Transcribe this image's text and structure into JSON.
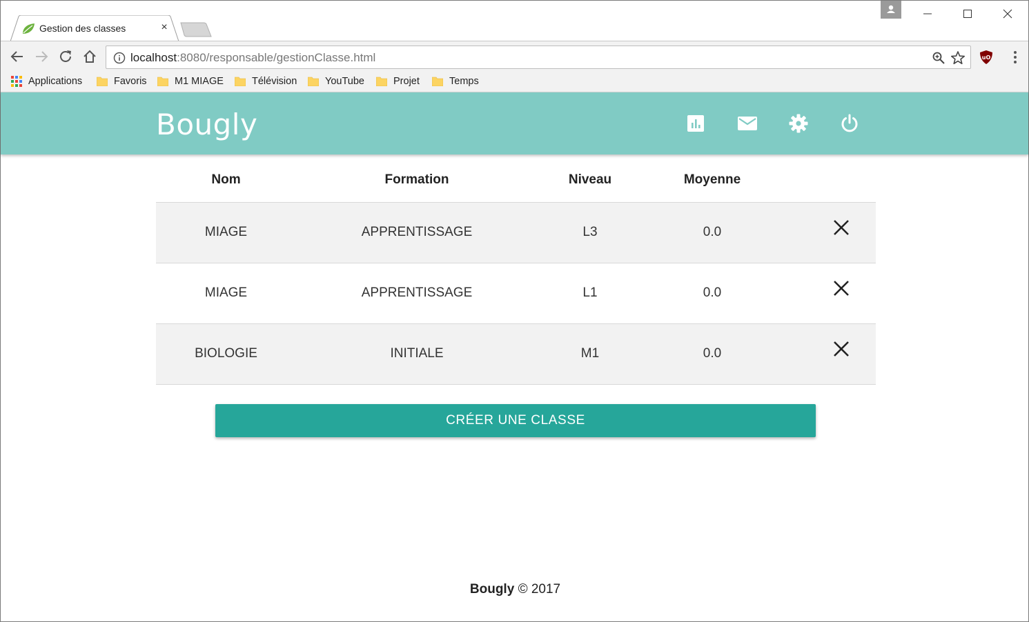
{
  "browser": {
    "tab_title": "Gestion des classes",
    "tab_close": "×",
    "url_host": "localhost",
    "url_rest": ":8080/responsable/gestionClasse.html",
    "bookmarks": [
      {
        "label": "Applications",
        "icon": "apps-grid-icon"
      },
      {
        "label": "Favoris",
        "icon": "folder-icon"
      },
      {
        "label": "M1 MIAGE",
        "icon": "folder-icon"
      },
      {
        "label": "Télévision",
        "icon": "folder-icon"
      },
      {
        "label": "YouTube",
        "icon": "folder-icon"
      },
      {
        "label": "Projet",
        "icon": "folder-icon"
      },
      {
        "label": "Temps",
        "icon": "folder-icon"
      }
    ]
  },
  "header": {
    "brand": "Bougly",
    "icons": [
      "chart-icon",
      "mail-icon",
      "settings-icon",
      "power-icon"
    ],
    "color": "#80cbc4"
  },
  "table": {
    "columns": [
      "Nom",
      "Formation",
      "Niveau",
      "Moyenne"
    ],
    "rows": [
      {
        "nom": "MIAGE",
        "formation": "APPRENTISSAGE",
        "niveau": "L3",
        "moyenne": "0.0"
      },
      {
        "nom": "MIAGE",
        "formation": "APPRENTISSAGE",
        "niveau": "L1",
        "moyenne": "0.0"
      },
      {
        "nom": "BIOLOGIE",
        "formation": "INITIALE",
        "niveau": "M1",
        "moyenne": "0.0"
      }
    ]
  },
  "create_button": {
    "label": "CRÉER UNE CLASSE",
    "color": "#26a69a"
  },
  "footer": {
    "brand": "Bougly",
    "copyright": "© 2017"
  }
}
